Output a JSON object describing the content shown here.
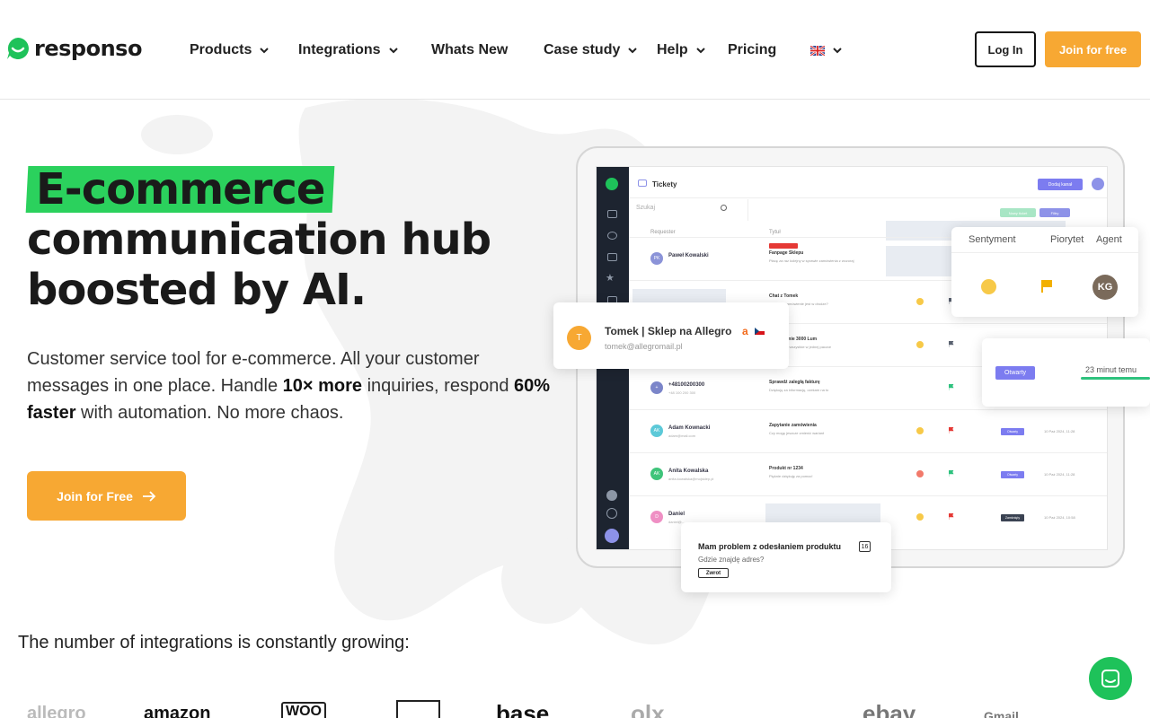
{
  "nav": {
    "logo_text": "responso",
    "items": [
      {
        "label": "Products",
        "has_dropdown": true
      },
      {
        "label": "Integrations",
        "has_dropdown": true
      },
      {
        "label": "Whats New",
        "has_dropdown": false
      },
      {
        "label": "Case study",
        "has_dropdown": true
      },
      {
        "label": "Help",
        "has_dropdown": true
      },
      {
        "label": "Pricing",
        "has_dropdown": false
      }
    ],
    "language_icon": "uk-flag-icon",
    "login_label": "Log In",
    "join_label": "Join for free"
  },
  "hero": {
    "title_highlight": "E-commerce",
    "title_line2": "communication hub",
    "title_line3": "boosted by AI.",
    "sub_part1": "Customer service tool for e-commerce. All your customer messages in one place. Handle ",
    "sub_bold1": "10× more",
    "sub_part2": " inquiries, respond ",
    "sub_bold2": "60% faster",
    "sub_part3": " with automation. No more chaos.",
    "cta_label": "Join for Free"
  },
  "app_preview": {
    "page_title": "Tickety",
    "add_channel": "Dodaj kanał",
    "search_placeholder": "Szukaj",
    "new_ticket": "Nowy ticket",
    "filters": "Filtry",
    "col_requester": "Requester",
    "col_title": "Tytuł",
    "rows": [
      {
        "initials": "PK",
        "name": "Paweł Kowalski",
        "sub": "",
        "title": "Fanpage Sklepu",
        "desc": "Płacę za raz kolejny w sprawie zamówienia z wczoraj",
        "status": "",
        "date": "",
        "avatar_color": "#8b93d8"
      },
      {
        "initials": "",
        "name": "",
        "sub": "",
        "title": "Chat z Tomek",
        "desc": "Czy moje zamówienie jest w drodze?",
        "status": "",
        "date": "",
        "avatar_color": "#cccccc"
      },
      {
        "initials": "",
        "name": "",
        "sub": "",
        "title": "Zamówienie 3000 Lum",
        "desc": "Tak, przyjdą wszystkie w jednej paczce",
        "status": "",
        "date": "",
        "avatar_color": "#cccccc"
      },
      {
        "initials": "+",
        "name": "+48100200300",
        "sub": "+48 100 200 300",
        "title": "Sprawdź zaległą fakturę",
        "desc": "Dziękuję za informację, czekam na to",
        "status": "",
        "date": "",
        "avatar_color": "#7b85c9"
      },
      {
        "initials": "AK",
        "name": "Adam Kownacki",
        "sub": "adam@mail.com",
        "title": "Zapytanie zamówienia",
        "desc": "Czy mogę jeszcze zmienić wariant",
        "status": "Otwarty",
        "date": "10 Paź 2024, 11:28",
        "avatar_color": "#5cc9d8"
      },
      {
        "initials": "AK",
        "name": "Anita Kowalska",
        "sub": "anita.kowalska@mojsklep.pl",
        "title": "Produkt nr 1234",
        "desc": "Pięknie dziękuję za pomoc!",
        "status": "Otwarty",
        "date": "10 Paź 2024, 11:28",
        "avatar_color": "#3ec47a"
      },
      {
        "initials": "D",
        "name": "Daniel",
        "sub": "daniel@...",
        "title": "",
        "desc": "",
        "status": "Zamknięty",
        "date": "10 Paź 2024, 10:58",
        "avatar_color": "#ef8fc4"
      }
    ],
    "sentiment_card": {
      "col1": "Sentyment",
      "col2": "Piorytet",
      "col3": "Agent",
      "agent_initials": "KG"
    },
    "contact_card": {
      "initial": "T",
      "name": "Tomek | Sklep na Allegro",
      "email": "tomek@allegromail.pl"
    },
    "status_card": {
      "status": "Otwarty",
      "time": "23 minut temu"
    },
    "message_card": {
      "title": "Mam problem z odesłaniem produktu",
      "count": "16",
      "text": "Gdzie znajdę adres?",
      "tag": "Zwrot"
    }
  },
  "integrations": {
    "heading": "The number of integrations is constantly growing:",
    "logos": [
      "allegro",
      "amazon",
      "WOO",
      "",
      "base",
      "olx",
      "",
      "ebay",
      "Gmail"
    ]
  },
  "colors": {
    "accent_orange": "#f7a833",
    "brand_green": "#2bd15d",
    "dark": "#1a1a1a"
  }
}
